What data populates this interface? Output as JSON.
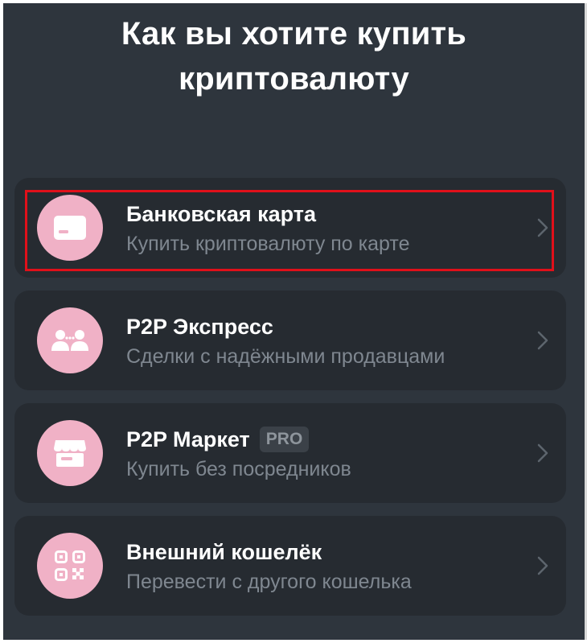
{
  "header": {
    "title_line1": "Как вы хотите купить",
    "title_line2": "криптовалюту"
  },
  "options": [
    {
      "label": "Банковская карта",
      "subtitle": "Купить криптовалюту по карте",
      "icon": "card-icon",
      "highlighted": true
    },
    {
      "label": "P2P Экспресс",
      "subtitle": "Сделки с надёжными продавцами",
      "icon": "users-exchange-icon"
    },
    {
      "label": "P2P Маркет",
      "badge": "PRO",
      "subtitle": "Купить без посредников",
      "icon": "storefront-icon"
    },
    {
      "label": "Внешний кошелёк",
      "subtitle": "Перевести с другого кошелька",
      "icon": "qr-code-icon"
    }
  ],
  "colors": {
    "background": "#2e353d",
    "card": "#262b31",
    "icon_circle": "#f0b1c6",
    "highlight": "#e0101a"
  }
}
